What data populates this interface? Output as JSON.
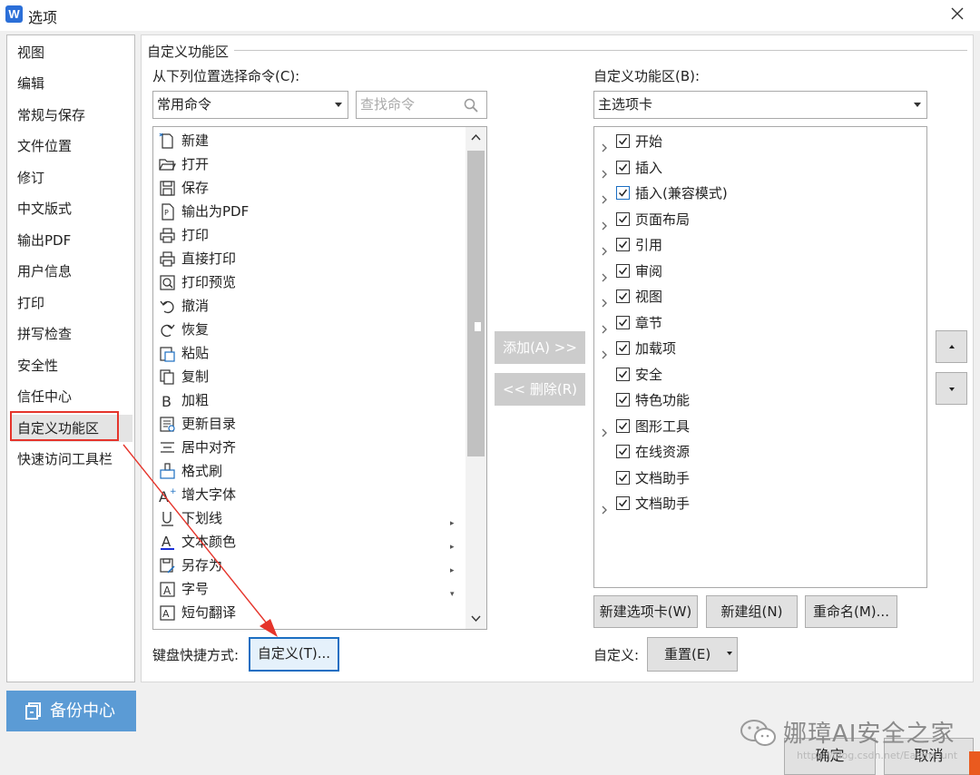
{
  "window": {
    "title": "选项"
  },
  "nav": {
    "items": [
      "视图",
      "编辑",
      "常规与保存",
      "文件位置",
      "修订",
      "中文版式",
      "输出PDF",
      "用户信息",
      "打印",
      "拼写检查",
      "安全性",
      "信任中心",
      "自定义功能区",
      "快速访问工具栏"
    ],
    "selected": "自定义功能区"
  },
  "section": {
    "title": "自定义功能区"
  },
  "left": {
    "label": "从下列位置选择命令(C):",
    "combo_value": "常用命令",
    "search_placeholder": "查找命令",
    "commands": [
      {
        "label": "新建",
        "icon": "new-doc-icon"
      },
      {
        "label": "打开",
        "icon": "folder-open-icon"
      },
      {
        "label": "保存",
        "icon": "save-icon"
      },
      {
        "label": "输出为PDF",
        "icon": "pdf-export-icon"
      },
      {
        "label": "打印",
        "icon": "printer-icon"
      },
      {
        "label": "直接打印",
        "icon": "direct-print-icon"
      },
      {
        "label": "打印预览",
        "icon": "print-preview-icon"
      },
      {
        "label": "撤消",
        "icon": "undo-icon"
      },
      {
        "label": "恢复",
        "icon": "redo-icon"
      },
      {
        "label": "粘贴",
        "icon": "paste-icon"
      },
      {
        "label": "复制",
        "icon": "copy-icon"
      },
      {
        "label": "加粗",
        "icon": "bold-icon"
      },
      {
        "label": "更新目录",
        "icon": "update-toc-icon"
      },
      {
        "label": "居中对齐",
        "icon": "align-center-icon"
      },
      {
        "label": "格式刷",
        "icon": "format-painter-icon"
      },
      {
        "label": "增大字体",
        "icon": "grow-font-icon"
      },
      {
        "label": "下划线",
        "icon": "underline-icon"
      },
      {
        "label": "文本颜色",
        "icon": "font-color-icon"
      },
      {
        "label": "另存为",
        "icon": "save-as-icon"
      },
      {
        "label": "字号",
        "icon": "font-size-icon"
      },
      {
        "label": "短句翻译",
        "icon": "translate-icon"
      }
    ],
    "keyboard_label": "键盘快捷方式:",
    "customize_button": "自定义(T)..."
  },
  "middle": {
    "add_button": "添加(A) >>",
    "remove_button": "<< 删除(R)"
  },
  "right": {
    "label": "自定义功能区(B):",
    "combo_value": "主选项卡",
    "tabs": [
      {
        "label": "开始",
        "expandable": true,
        "checked": true
      },
      {
        "label": "插入",
        "expandable": true,
        "checked": true
      },
      {
        "label": "插入(兼容模式)",
        "expandable": true,
        "checked": true
      },
      {
        "label": "页面布局",
        "expandable": true,
        "checked": true
      },
      {
        "label": "引用",
        "expandable": true,
        "checked": true
      },
      {
        "label": "审阅",
        "expandable": true,
        "checked": true
      },
      {
        "label": "视图",
        "expandable": true,
        "checked": true
      },
      {
        "label": "章节",
        "expandable": true,
        "checked": true
      },
      {
        "label": "加载项",
        "expandable": true,
        "checked": true
      },
      {
        "label": "安全",
        "expandable": false,
        "checked": true
      },
      {
        "label": "特色功能",
        "expandable": false,
        "checked": true
      },
      {
        "label": "图形工具",
        "expandable": true,
        "checked": true
      },
      {
        "label": "在线资源",
        "expandable": false,
        "checked": true
      },
      {
        "label": "文档助手",
        "expandable": false,
        "checked": true
      },
      {
        "label": "文档助手",
        "expandable": true,
        "checked": true
      }
    ],
    "new_tab_button": "新建选项卡(W)",
    "new_group_button": "新建组(N)",
    "rename_button": "重命名(M)...",
    "custom_label": "自定义:",
    "reset_button": "重置(E)"
  },
  "footer": {
    "backup_button": "备份中心",
    "ok_button": "确定",
    "cancel_button": "取消"
  },
  "watermark": {
    "text": "娜璋AI安全之家",
    "url": "https://blog.csdn.net/Eastmount"
  },
  "colors": {
    "accent": "#1b6ec2",
    "highlight_red": "#e5342b",
    "backup_blue": "#5b9bd5",
    "disabled": "#cccccc"
  }
}
